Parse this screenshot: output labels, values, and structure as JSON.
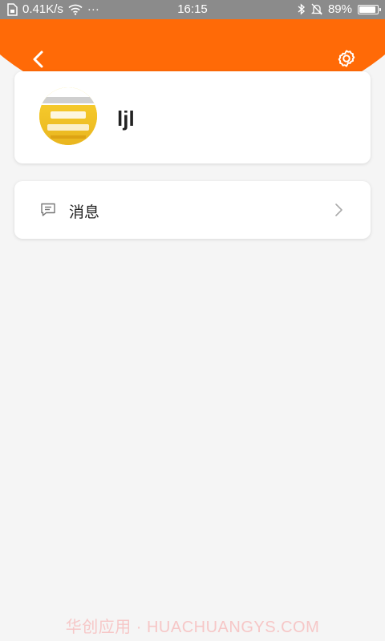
{
  "status_bar": {
    "network_speed": "0.41K/s",
    "overflow_dots": "···",
    "time": "16:15",
    "battery_percent": "89%",
    "battery_level": 0.89
  },
  "header": {
    "back_icon": "chevron-left-icon",
    "settings_icon": "gear-icon",
    "accent_color": "#ff6a07"
  },
  "profile": {
    "avatar_icon": "avatar-image",
    "username": "ljl"
  },
  "menu": {
    "message": {
      "icon": "message-bubble-icon",
      "label": "消息",
      "chevron_icon": "chevron-right-icon"
    }
  },
  "watermark": "华创应用 · HUACHUANGYS.COM"
}
